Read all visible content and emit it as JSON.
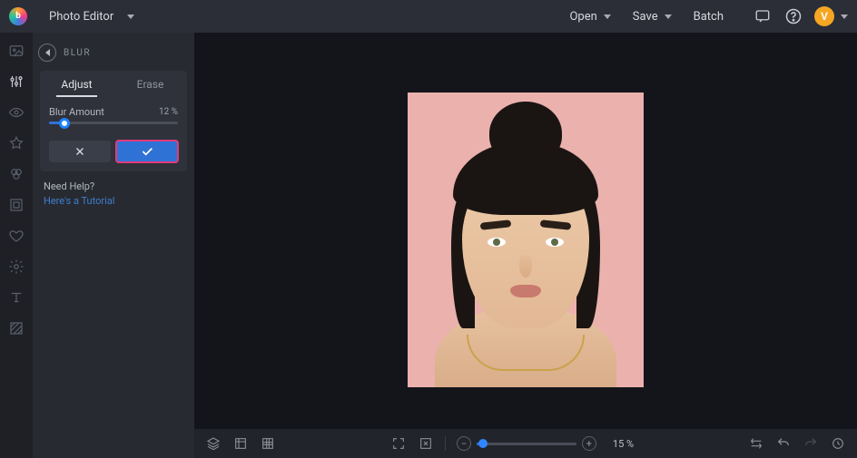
{
  "header": {
    "app_title": "Photo Editor",
    "open_label": "Open",
    "save_label": "Save",
    "batch_label": "Batch",
    "avatar_initial": "V"
  },
  "panel": {
    "title": "BLUR",
    "tabs": {
      "adjust": "Adjust",
      "erase": "Erase"
    },
    "blur_amount_label": "Blur Amount",
    "blur_amount_value": "12 %",
    "blur_amount_percent": 12,
    "help_title": "Need Help?",
    "help_link": "Here's a Tutorial"
  },
  "bottom": {
    "zoom_label": "15 %",
    "zoom_percent": 15
  }
}
